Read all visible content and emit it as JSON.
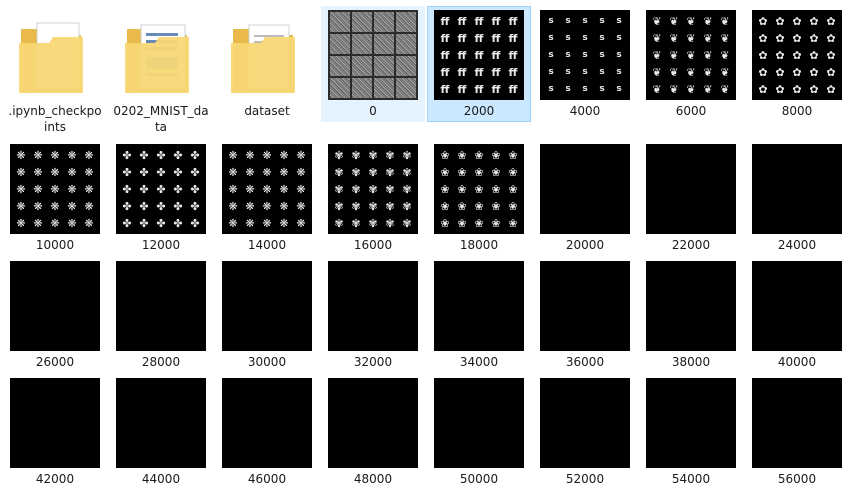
{
  "folders": [
    {
      "label": ".ipynb_checkpoints",
      "icon": "folder-with-page-icon"
    },
    {
      "label": "0202_MNIST_data",
      "icon": "folder-with-documents-icon"
    },
    {
      "label": "dataset",
      "icon": "folder-icon"
    }
  ],
  "images": [
    {
      "label": "0",
      "kind": "noise",
      "state": "hover"
    },
    {
      "label": "2000",
      "kind": "digits",
      "state": "selected",
      "glyph": "ff",
      "grid": 5
    },
    {
      "label": "4000",
      "kind": "digits",
      "glyph": "s",
      "grid": 5,
      "sparse": true
    },
    {
      "label": "6000",
      "kind": "digits",
      "glyph": "❦",
      "grid": 5
    },
    {
      "label": "8000",
      "kind": "digits",
      "glyph": "✿",
      "grid": 5
    },
    {
      "label": "10000",
      "kind": "digits",
      "glyph": "❋",
      "grid": 5
    },
    {
      "label": "12000",
      "kind": "digits",
      "glyph": "✤",
      "grid": 5
    },
    {
      "label": "14000",
      "kind": "digits",
      "glyph": "❋",
      "grid": 5
    },
    {
      "label": "16000",
      "kind": "digits",
      "glyph": "✾",
      "grid": 5
    },
    {
      "label": "18000",
      "kind": "digits",
      "glyph": "❀",
      "grid": 5
    },
    {
      "label": "20000",
      "kind": "black"
    },
    {
      "label": "22000",
      "kind": "black"
    },
    {
      "label": "24000",
      "kind": "black"
    },
    {
      "label": "26000",
      "kind": "black"
    },
    {
      "label": "28000",
      "kind": "black"
    },
    {
      "label": "30000",
      "kind": "black"
    },
    {
      "label": "32000",
      "kind": "black"
    },
    {
      "label": "34000",
      "kind": "black"
    },
    {
      "label": "36000",
      "kind": "black"
    },
    {
      "label": "38000",
      "kind": "black"
    },
    {
      "label": "40000",
      "kind": "black"
    },
    {
      "label": "42000",
      "kind": "black"
    },
    {
      "label": "44000",
      "kind": "black"
    },
    {
      "label": "46000",
      "kind": "black"
    },
    {
      "label": "48000",
      "kind": "black"
    },
    {
      "label": "50000",
      "kind": "black"
    },
    {
      "label": "52000",
      "kind": "black"
    },
    {
      "label": "54000",
      "kind": "black"
    },
    {
      "label": "56000",
      "kind": "black"
    }
  ],
  "colors": {
    "selected": "#cce8ff",
    "hover": "#e5f3ff",
    "folder": "#f8d775"
  }
}
